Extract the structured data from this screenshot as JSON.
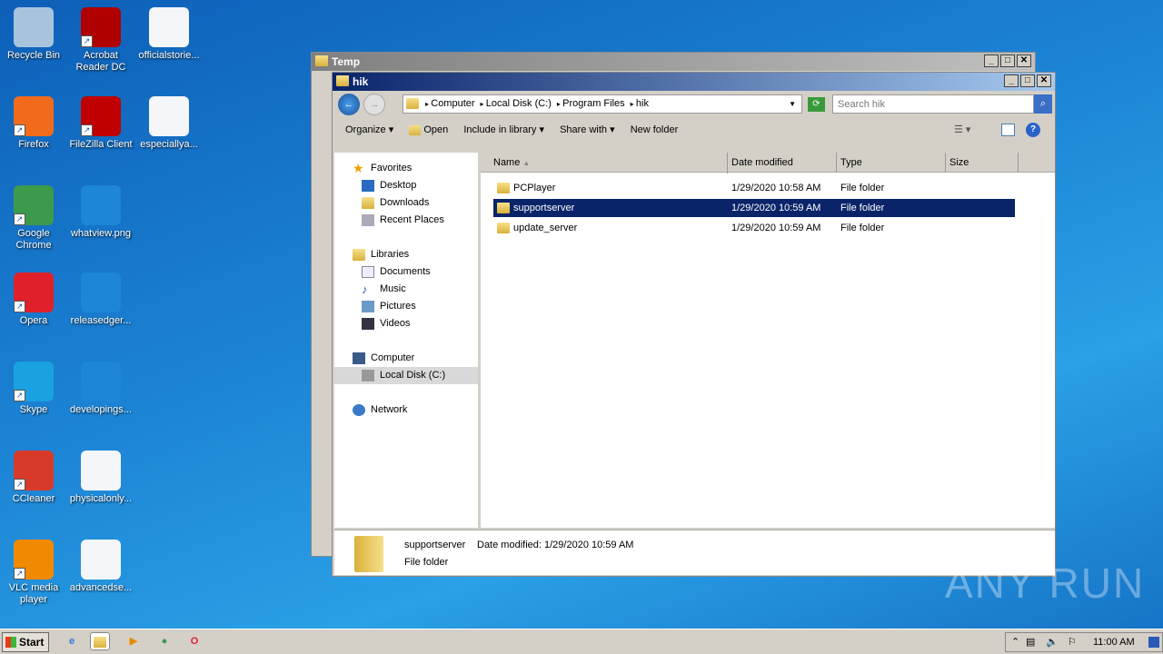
{
  "desktop_icons": [
    {
      "label": "Recycle Bin",
      "icon": "recycle-bin-icon",
      "color": "#a8c4dc"
    },
    {
      "label": "Firefox",
      "icon": "firefox-icon",
      "color": "#f26b1d"
    },
    {
      "label": "Google Chrome",
      "icon": "chrome-icon",
      "color": "#3c9a4a"
    },
    {
      "label": "Opera",
      "icon": "opera-icon",
      "color": "#e0202a"
    },
    {
      "label": "Skype",
      "icon": "skype-icon",
      "color": "#1aa1e0"
    },
    {
      "label": "CCleaner",
      "icon": "ccleaner-icon",
      "color": "#d83a2a"
    },
    {
      "label": "VLC media player",
      "icon": "vlc-icon",
      "color": "#f08a00"
    },
    {
      "label": "Acrobat Reader DC",
      "icon": "acrobat-icon",
      "color": "#b00000"
    },
    {
      "label": "FileZilla Client",
      "icon": "filezilla-icon",
      "color": "#c00000"
    },
    {
      "label": "whatview.png",
      "icon": "image-file-icon",
      "color": "#1d86d6"
    },
    {
      "label": "releasedger...",
      "icon": "file-icon",
      "color": "#1d86d6"
    },
    {
      "label": "developings...",
      "icon": "file-icon",
      "color": "#1d86d6"
    },
    {
      "label": "physicalonly...",
      "icon": "word-doc-icon",
      "color": "#f4f6fa"
    },
    {
      "label": "advancedse...",
      "icon": "word-doc-icon",
      "color": "#f4f6fa"
    },
    {
      "label": "officialstorie...",
      "icon": "word-doc-icon",
      "color": "#f4f6fa"
    },
    {
      "label": "especiallya...",
      "icon": "word-doc-icon",
      "color": "#f4f6fa"
    }
  ],
  "back_window": {
    "title": "Temp"
  },
  "window": {
    "title": "hik",
    "breadcrumb": [
      "Computer",
      "Local Disk (C:)",
      "Program Files",
      "hik"
    ],
    "search_placeholder": "Search hik",
    "toolbar": {
      "organize": "Organize",
      "open": "Open",
      "include": "Include in library",
      "share": "Share with",
      "new_folder": "New folder"
    },
    "nav": {
      "favorites": "Favorites",
      "desktop": "Desktop",
      "downloads": "Downloads",
      "recent": "Recent Places",
      "libraries": "Libraries",
      "documents": "Documents",
      "music": "Music",
      "pictures": "Pictures",
      "videos": "Videos",
      "computer": "Computer",
      "local_disk": "Local Disk (C:)",
      "network": "Network"
    },
    "columns": {
      "name": "Name",
      "date": "Date modified",
      "type": "Type",
      "size": "Size"
    },
    "files": [
      {
        "name": "PCPlayer",
        "date": "1/29/2020 10:58 AM",
        "type": "File folder"
      },
      {
        "name": "supportserver",
        "date": "1/29/2020 10:59 AM",
        "type": "File folder",
        "selected": true
      },
      {
        "name": "update_server",
        "date": "1/29/2020 10:59 AM",
        "type": "File folder"
      }
    ],
    "details": {
      "name": "supportserver",
      "date_label": "Date modified:",
      "date": "1/29/2020 10:59 AM",
      "type": "File folder"
    }
  },
  "taskbar": {
    "start": "Start",
    "clock": "11:00 AM"
  },
  "watermark": "ANY RUN"
}
